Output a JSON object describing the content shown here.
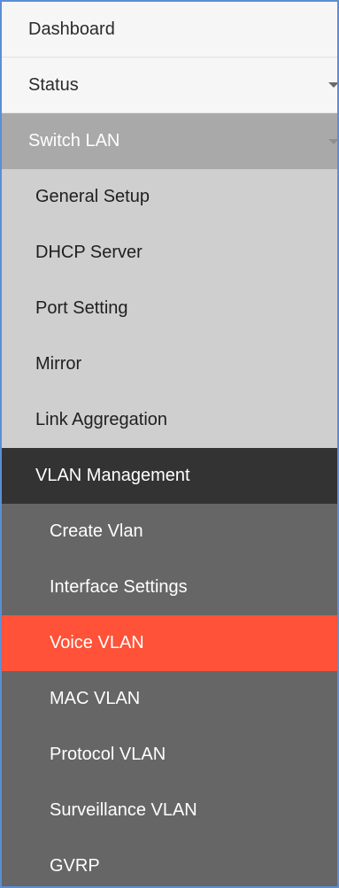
{
  "menu": {
    "dashboard": "Dashboard",
    "status": "Status",
    "switch_lan": "Switch LAN",
    "switch_lan_items": [
      "General Setup",
      "DHCP Server",
      "Port Setting",
      "Mirror",
      "Link Aggregation"
    ],
    "vlan_management": "VLAN Management",
    "vlan_items": [
      "Create Vlan",
      "Interface Settings",
      "Voice VLAN",
      "MAC VLAN",
      "Protocol VLAN",
      "Surveillance VLAN",
      "GVRP"
    ],
    "active_item": "Voice VLAN"
  },
  "icons": {
    "status_caret": "caret-down-icon",
    "switch_lan_caret": "caret-down-icon"
  },
  "colors": {
    "frame_border": "#5b8fd6",
    "active_accent": "#ff5238",
    "section_gray": "#a9a9a9",
    "submenu_light": "#cfcfcf",
    "submenu_dark": "#333333",
    "nested_submenu": "#666666"
  }
}
